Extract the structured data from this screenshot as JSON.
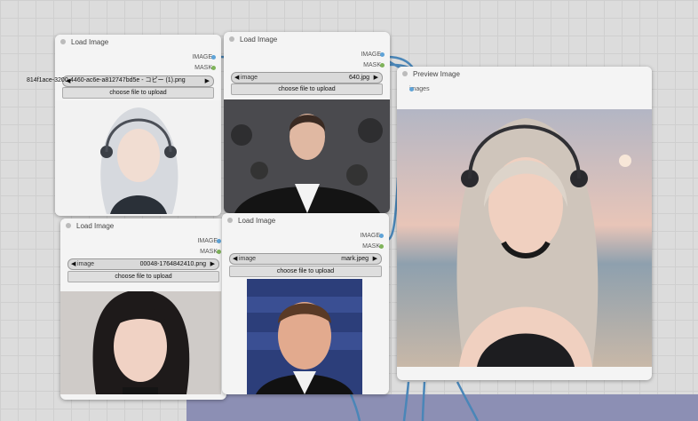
{
  "nodes": {
    "load1": {
      "title": "Load Image",
      "outputs": {
        "image": "IMAGE",
        "mask": "MASK"
      },
      "widget": {
        "label": "image",
        "value": "814f1ace-3200-4460-ac6e-a812747bd5e - コピー (1).png"
      },
      "button": "choose file to upload"
    },
    "load2": {
      "title": "Load Image",
      "outputs": {
        "image": "IMAGE",
        "mask": "MASK"
      },
      "widget": {
        "label": "image",
        "value": "640.jpg"
      },
      "button": "choose file to upload"
    },
    "load3": {
      "title": "Load Image",
      "outputs": {
        "image": "IMAGE",
        "mask": "MASK"
      },
      "widget": {
        "label": "image",
        "value": "00048-1764842410.png"
      },
      "button": "choose file to upload"
    },
    "load4": {
      "title": "Load Image",
      "outputs": {
        "image": "IMAGE",
        "mask": "MASK"
      },
      "widget": {
        "label": "image",
        "value": "mark.jpeg"
      },
      "button": "choose file to upload"
    },
    "preview": {
      "title": "Preview Image",
      "input": "images"
    }
  },
  "colors": {
    "image_pin": "#5fa3d7",
    "mask_pin": "#7fb35a",
    "link": "#4a86b8",
    "group": "#8c8fb4"
  }
}
